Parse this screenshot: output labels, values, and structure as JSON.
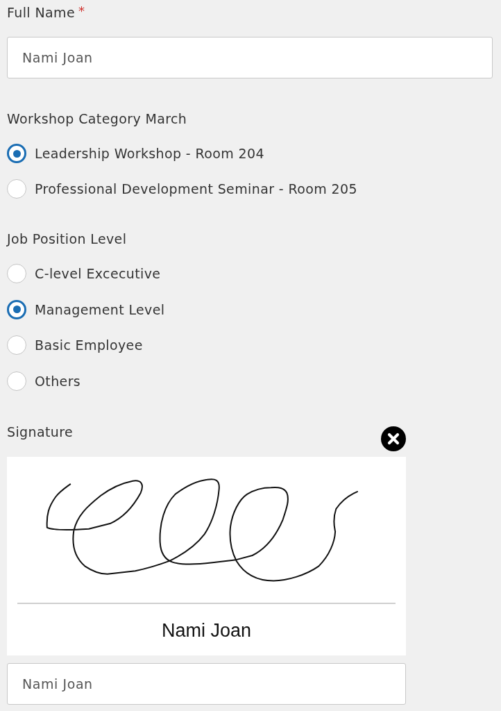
{
  "full_name": {
    "label": "Full Name",
    "required_mark": "*",
    "value": "Nami Joan"
  },
  "workshop_category": {
    "label": "Workshop Category March",
    "options": [
      {
        "label": "Leadership Workshop - Room 204",
        "selected": true
      },
      {
        "label": "Professional Development Seminar - Room 205",
        "selected": false
      }
    ]
  },
  "job_position_level": {
    "label": "Job Position Level",
    "options": [
      {
        "label": "C-level Excecutive",
        "selected": false
      },
      {
        "label": "Management Level",
        "selected": true
      },
      {
        "label": "Basic Employee",
        "selected": false
      },
      {
        "label": "Others",
        "selected": false
      }
    ]
  },
  "signature": {
    "label": "Signature",
    "signer_name": "Nami Joan",
    "name_field": {
      "value": "Nami Joan"
    }
  }
}
